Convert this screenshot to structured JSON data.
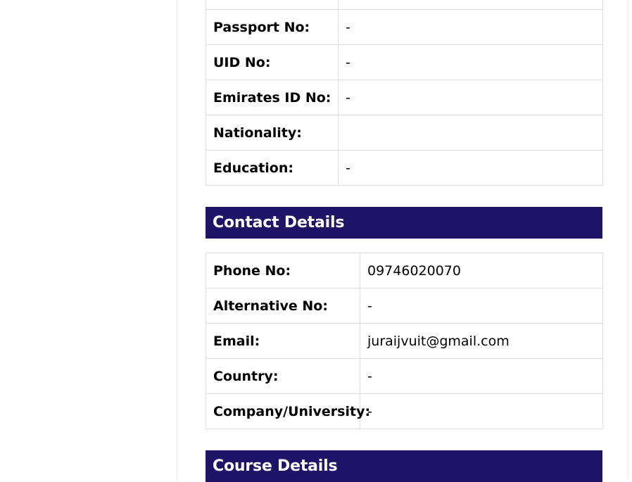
{
  "personal": {
    "rows": [
      {
        "label": "",
        "value": ""
      },
      {
        "label": "Passport No:",
        "value": "-"
      },
      {
        "label": "UID No:",
        "value": "-"
      },
      {
        "label": "Emirates ID No:",
        "value": "-"
      },
      {
        "label": "Nationality:",
        "value": ""
      },
      {
        "label": "Education:",
        "value": "-"
      }
    ]
  },
  "contact": {
    "title": "Contact Details",
    "rows": [
      {
        "label": "Phone No:",
        "value": "09746020070"
      },
      {
        "label": "Alternative No:",
        "value": "-"
      },
      {
        "label": "Email:",
        "value": "juraijvuit@gmail.com"
      },
      {
        "label": "Country:",
        "value": "-"
      },
      {
        "label": "Company/University:",
        "value": "-"
      }
    ]
  },
  "course": {
    "title": "Course Details"
  },
  "colors": {
    "header_background": "#1e1467",
    "header_text": "#ffffff",
    "border": "#dedede"
  }
}
